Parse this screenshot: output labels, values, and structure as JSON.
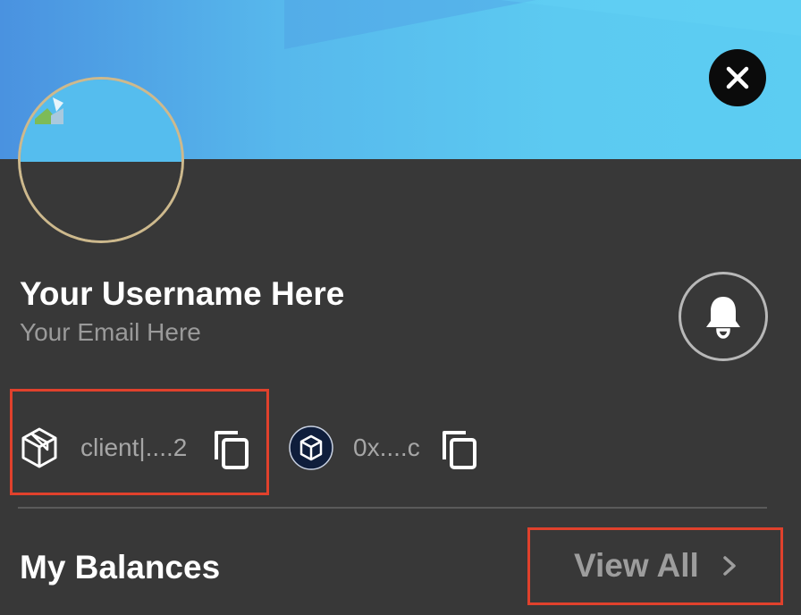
{
  "profile": {
    "username": "Your Username Here",
    "email": "Your Email Here"
  },
  "wallets": [
    {
      "address": "client|....2",
      "icon": "cube-outline-icon"
    },
    {
      "address": "0x....c",
      "icon": "cube-badge-icon"
    }
  ],
  "balances": {
    "title": "My Balances",
    "view_all_label": "View All"
  },
  "colors": {
    "panel": "#383838",
    "banner": "#5ccaf1",
    "highlight": "#e0412c",
    "avatar_ring": "#cdb98d"
  }
}
